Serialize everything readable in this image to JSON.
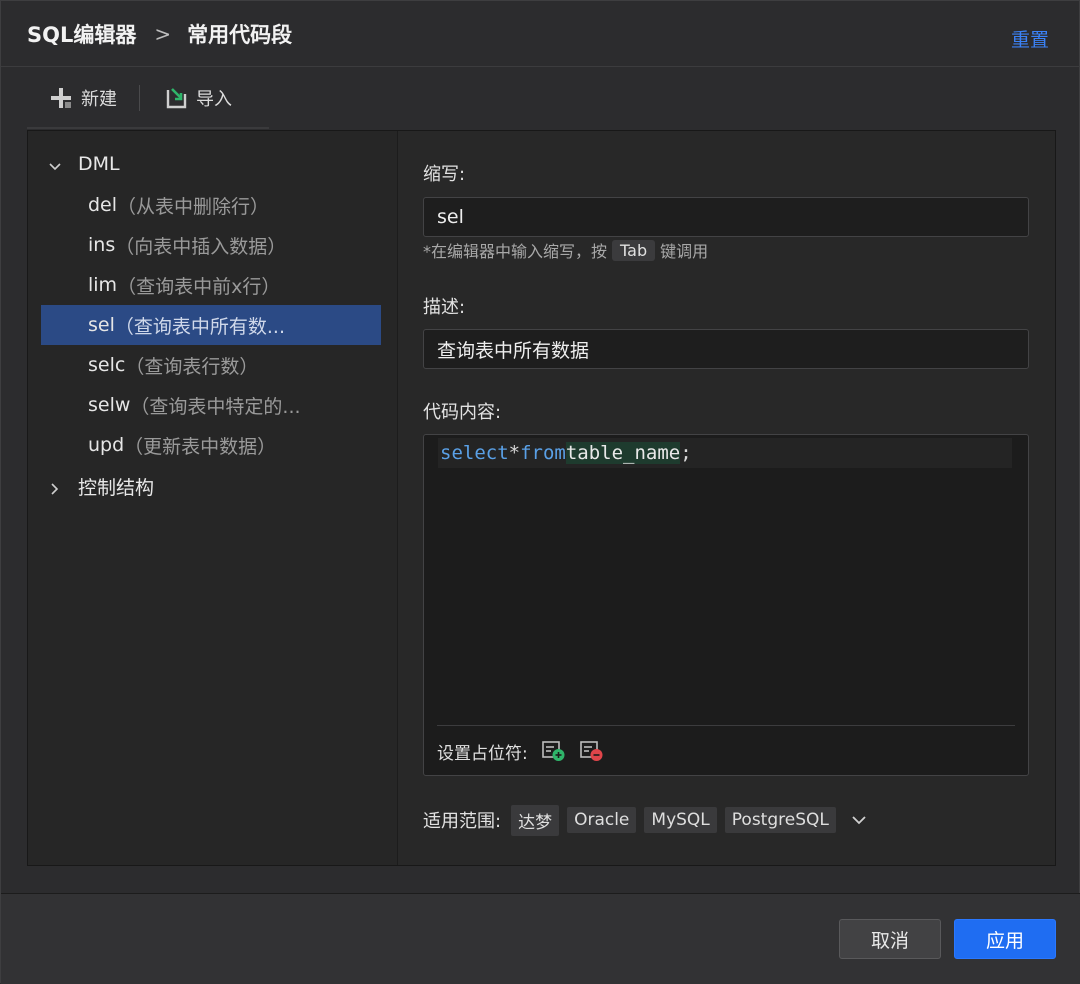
{
  "header": {
    "breadcrumb_root": "SQL编辑器",
    "breadcrumb_sep": ">",
    "breadcrumb_leaf": "常用代码段",
    "reset_label": "重置"
  },
  "toolbar": {
    "new_label": "新建",
    "import_label": "导入"
  },
  "tree": {
    "groups": [
      {
        "label": "DML",
        "expanded": true
      },
      {
        "label": "控制结构",
        "expanded": false
      }
    ],
    "items": [
      {
        "abbr": "del",
        "desc": "（从表中删除行）"
      },
      {
        "abbr": "ins",
        "desc": "（向表中插入数据）"
      },
      {
        "abbr": "lim",
        "desc": "（查询表中前x行）"
      },
      {
        "abbr": "sel",
        "desc": "（查询表中所有数...",
        "selected": true
      },
      {
        "abbr": "selc",
        "desc": "（查询表行数）"
      },
      {
        "abbr": "selw",
        "desc": "（查询表中特定的..."
      },
      {
        "abbr": "upd",
        "desc": "（更新表中数据）"
      }
    ]
  },
  "form": {
    "abbr_label": "缩写:",
    "abbr_value": "sel",
    "hint_prefix": "*在编辑器中输入缩写，按",
    "hint_key": "Tab",
    "hint_suffix": "键调用",
    "desc_label": "描述:",
    "desc_value": "查询表中所有数据",
    "code_label": "代码内容:",
    "code": {
      "kw1": "select",
      "op": "*",
      "kw2": "from",
      "ident": "table_name",
      "semi": ";"
    },
    "placeholder_label": "设置占位符:",
    "scope_label": "适用范围:",
    "scope_tags": [
      "达梦",
      "Oracle",
      "MySQL",
      "PostgreSQL"
    ]
  },
  "footer": {
    "cancel_label": "取消",
    "apply_label": "应用"
  },
  "colors": {
    "accent": "#1f6df2",
    "link": "#3b82f6",
    "selection": "#2b4a85",
    "keyword": "#5aa0e6",
    "placeholder_add": "#2fb56a",
    "placeholder_remove": "#e0454a"
  },
  "icons": {
    "new": "plus-icon",
    "import": "import-icon",
    "expand": "chevron-down-icon",
    "collapse": "chevron-right-icon",
    "add_placeholder": "add-placeholder-icon",
    "remove_placeholder": "remove-placeholder-icon",
    "scope_dropdown": "chevron-down-icon"
  }
}
